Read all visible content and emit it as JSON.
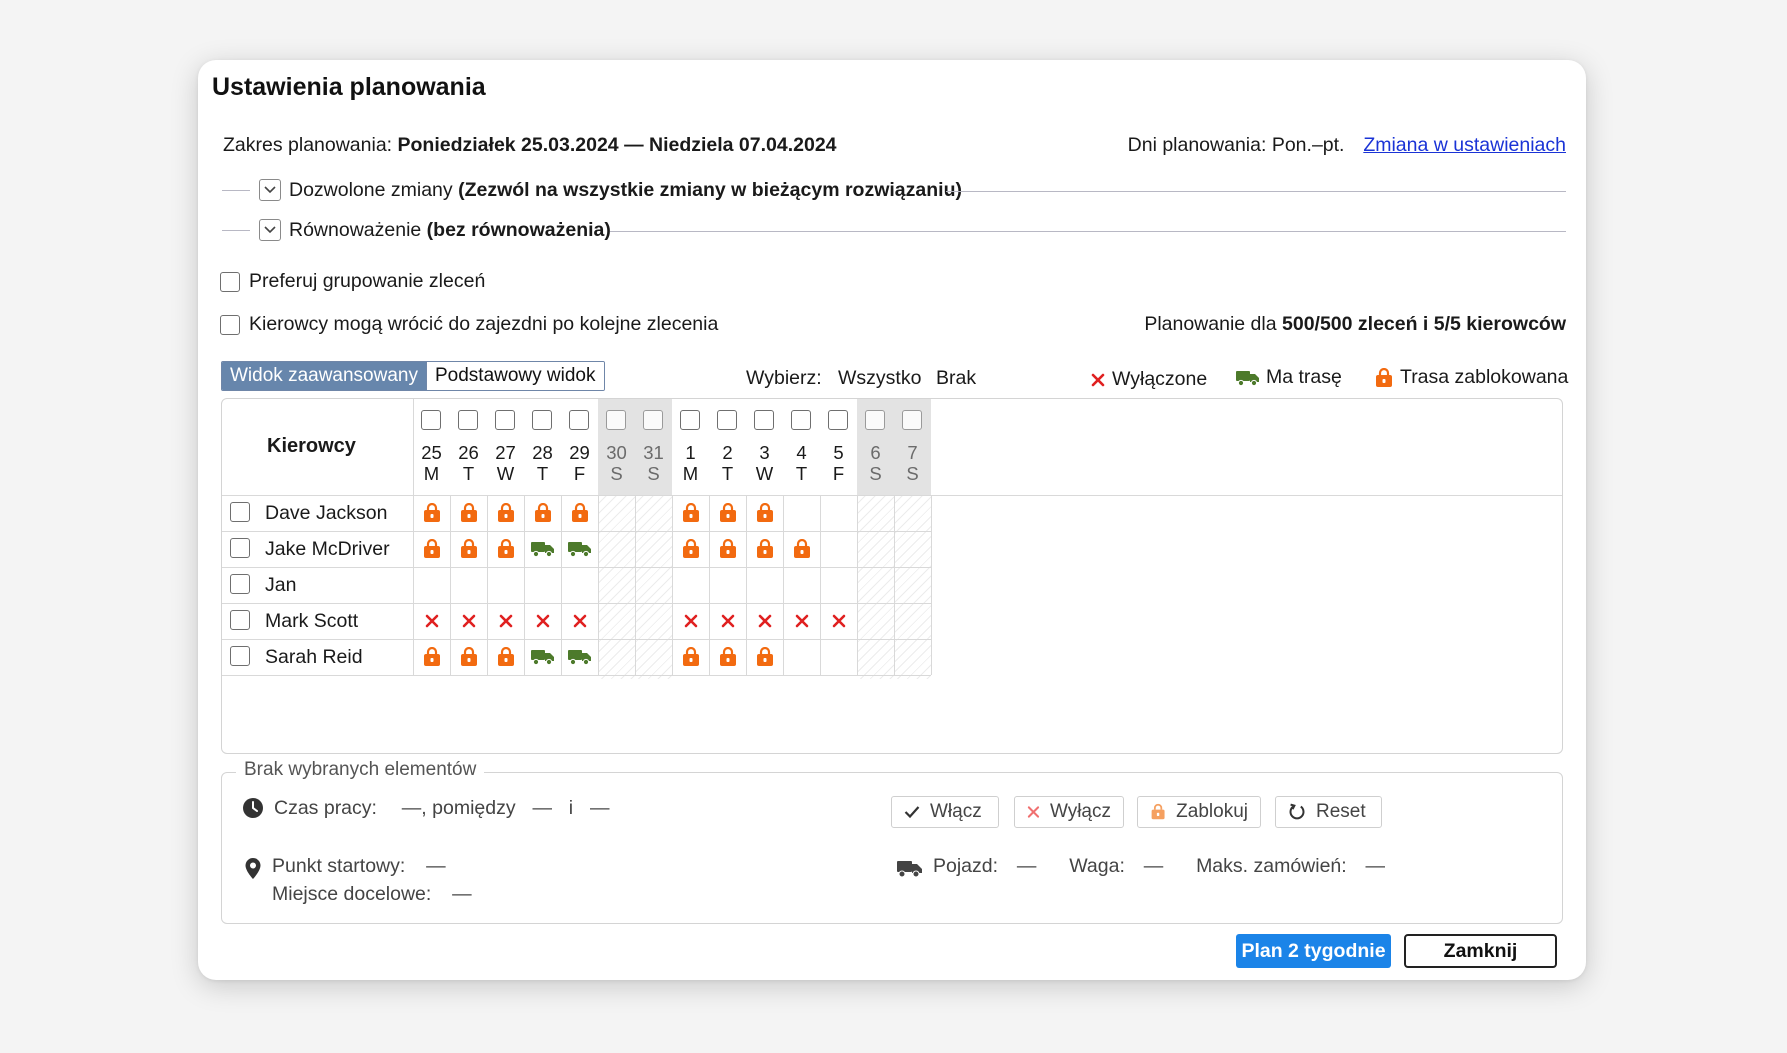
{
  "dialog": {
    "title": "Ustawienia planowania",
    "range_label": "Zakres planowania:",
    "range_value": "Poniedziałek 25.03.2024 — Niedziela 07.04.2024",
    "days_label": "Dni planowania:",
    "days_value": "Pon.–pt.",
    "settings_link": "Zmiana w ustawieniach"
  },
  "sections": {
    "changes_label": "Dozwolone zmiany",
    "changes_value": "(Zezwól na wszystkie zmiany w bieżącym rozwiązaniu)",
    "balance_label": "Równoważenie",
    "balance_value": "(bez równoważenia)"
  },
  "options": {
    "group_orders": "Preferuj grupowanie zleceń",
    "return_depot": "Kierowcy mogą wrócić do zajezdni po kolejne zlecenia"
  },
  "summary": {
    "prefix": "Planowanie dla",
    "value": "500/500 zleceń i 5/5 kierowców"
  },
  "view_toggle": {
    "advanced": "Widok zaawansowany",
    "basic": "Podstawowy widok"
  },
  "select": {
    "label": "Wybierz:",
    "all": "Wszystko",
    "none": "Brak"
  },
  "legend": {
    "disabled": "Wyłączone",
    "has_route": "Ma trasę",
    "locked": "Trasa zablokowana"
  },
  "colors": {
    "locked": "#f26a10",
    "route": "#4d7a2b",
    "disabled": "#e02020",
    "primary": "#1b84e8",
    "toggle_active": "#6786ac"
  },
  "grid": {
    "drivers_header": "Kierowcy",
    "days": [
      {
        "num": "25",
        "wd": "M",
        "weekend": false
      },
      {
        "num": "26",
        "wd": "T",
        "weekend": false
      },
      {
        "num": "27",
        "wd": "W",
        "weekend": false
      },
      {
        "num": "28",
        "wd": "T",
        "weekend": false
      },
      {
        "num": "29",
        "wd": "F",
        "weekend": false
      },
      {
        "num": "30",
        "wd": "S",
        "weekend": true
      },
      {
        "num": "31",
        "wd": "S",
        "weekend": true
      },
      {
        "num": "1",
        "wd": "M",
        "weekend": false
      },
      {
        "num": "2",
        "wd": "T",
        "weekend": false
      },
      {
        "num": "3",
        "wd": "W",
        "weekend": false
      },
      {
        "num": "4",
        "wd": "T",
        "weekend": false
      },
      {
        "num": "5",
        "wd": "F",
        "weekend": false
      },
      {
        "num": "6",
        "wd": "S",
        "weekend": true
      },
      {
        "num": "7",
        "wd": "S",
        "weekend": true
      }
    ],
    "drivers": [
      {
        "name": "Dave Jackson",
        "cells": [
          "lock",
          "lock",
          "lock",
          "lock",
          "lock",
          "",
          "",
          "lock",
          "lock",
          "lock",
          "",
          "",
          "",
          ""
        ]
      },
      {
        "name": "Jake McDriver",
        "cells": [
          "lock",
          "lock",
          "lock",
          "truck",
          "truck",
          "",
          "",
          "lock",
          "lock",
          "lock",
          "lock",
          "",
          "",
          ""
        ]
      },
      {
        "name": "Jan",
        "cells": [
          "",
          "",
          "",
          "",
          "",
          "",
          "",
          "",
          "",
          "",
          "",
          "",
          "",
          ""
        ]
      },
      {
        "name": "Mark Scott",
        "cells": [
          "x",
          "x",
          "x",
          "x",
          "x",
          "",
          "",
          "x",
          "x",
          "x",
          "x",
          "x",
          "",
          ""
        ]
      },
      {
        "name": "Sarah Reid",
        "cells": [
          "lock",
          "lock",
          "lock",
          "truck",
          "truck",
          "",
          "",
          "lock",
          "lock",
          "lock",
          "",
          "",
          "",
          ""
        ]
      }
    ]
  },
  "selection": {
    "legend": "Brak wybranych elementów",
    "work_time_label": "Czas pracy:",
    "work_time_from": "—,",
    "between": "pomiędzy",
    "time_start": "—",
    "and": "i",
    "time_end": "—",
    "start_label": "Punkt startowy:",
    "start_value": "—",
    "dest_label": "Miejsce docelowe:",
    "dest_value": "—",
    "vehicle_label": "Pojazd:",
    "vehicle_value": "—",
    "weight_label": "Waga:",
    "weight_value": "—",
    "max_orders_label": "Maks. zamówień:",
    "max_orders_value": "—",
    "btn_enable": "Włącz",
    "btn_disable": "Wyłącz",
    "btn_lock": "Zablokuj",
    "btn_reset": "Reset"
  },
  "footer": {
    "plan_button": "Plan 2 tygodnie",
    "close_button": "Zamknij"
  }
}
